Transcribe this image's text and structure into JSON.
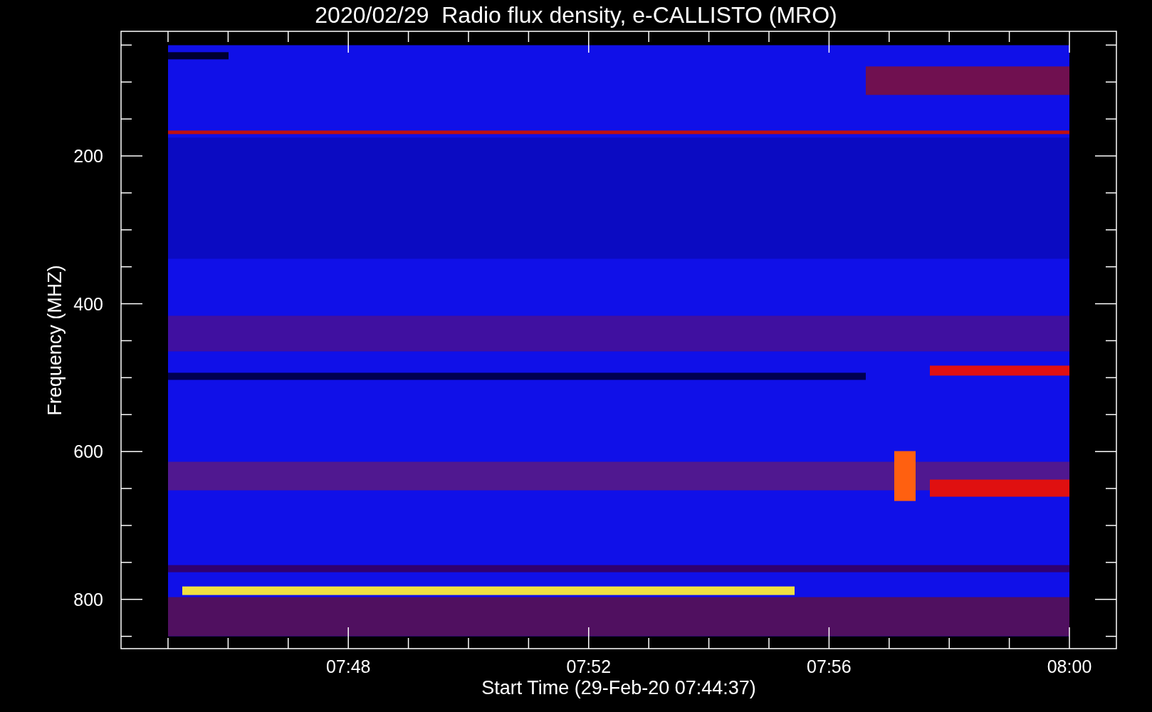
{
  "title": "2020/02/29  Radio flux density, e-CALLISTO (MRO)",
  "y_axis": {
    "label": "Frequency (MHZ)",
    "tick_labels": [
      "200",
      "400",
      "600",
      "800"
    ]
  },
  "x_axis": {
    "label": "Start Time (29-Feb-20 07:44:37)",
    "tick_labels": [
      "07:48",
      "07:52",
      "07:56",
      "08:00"
    ]
  }
}
